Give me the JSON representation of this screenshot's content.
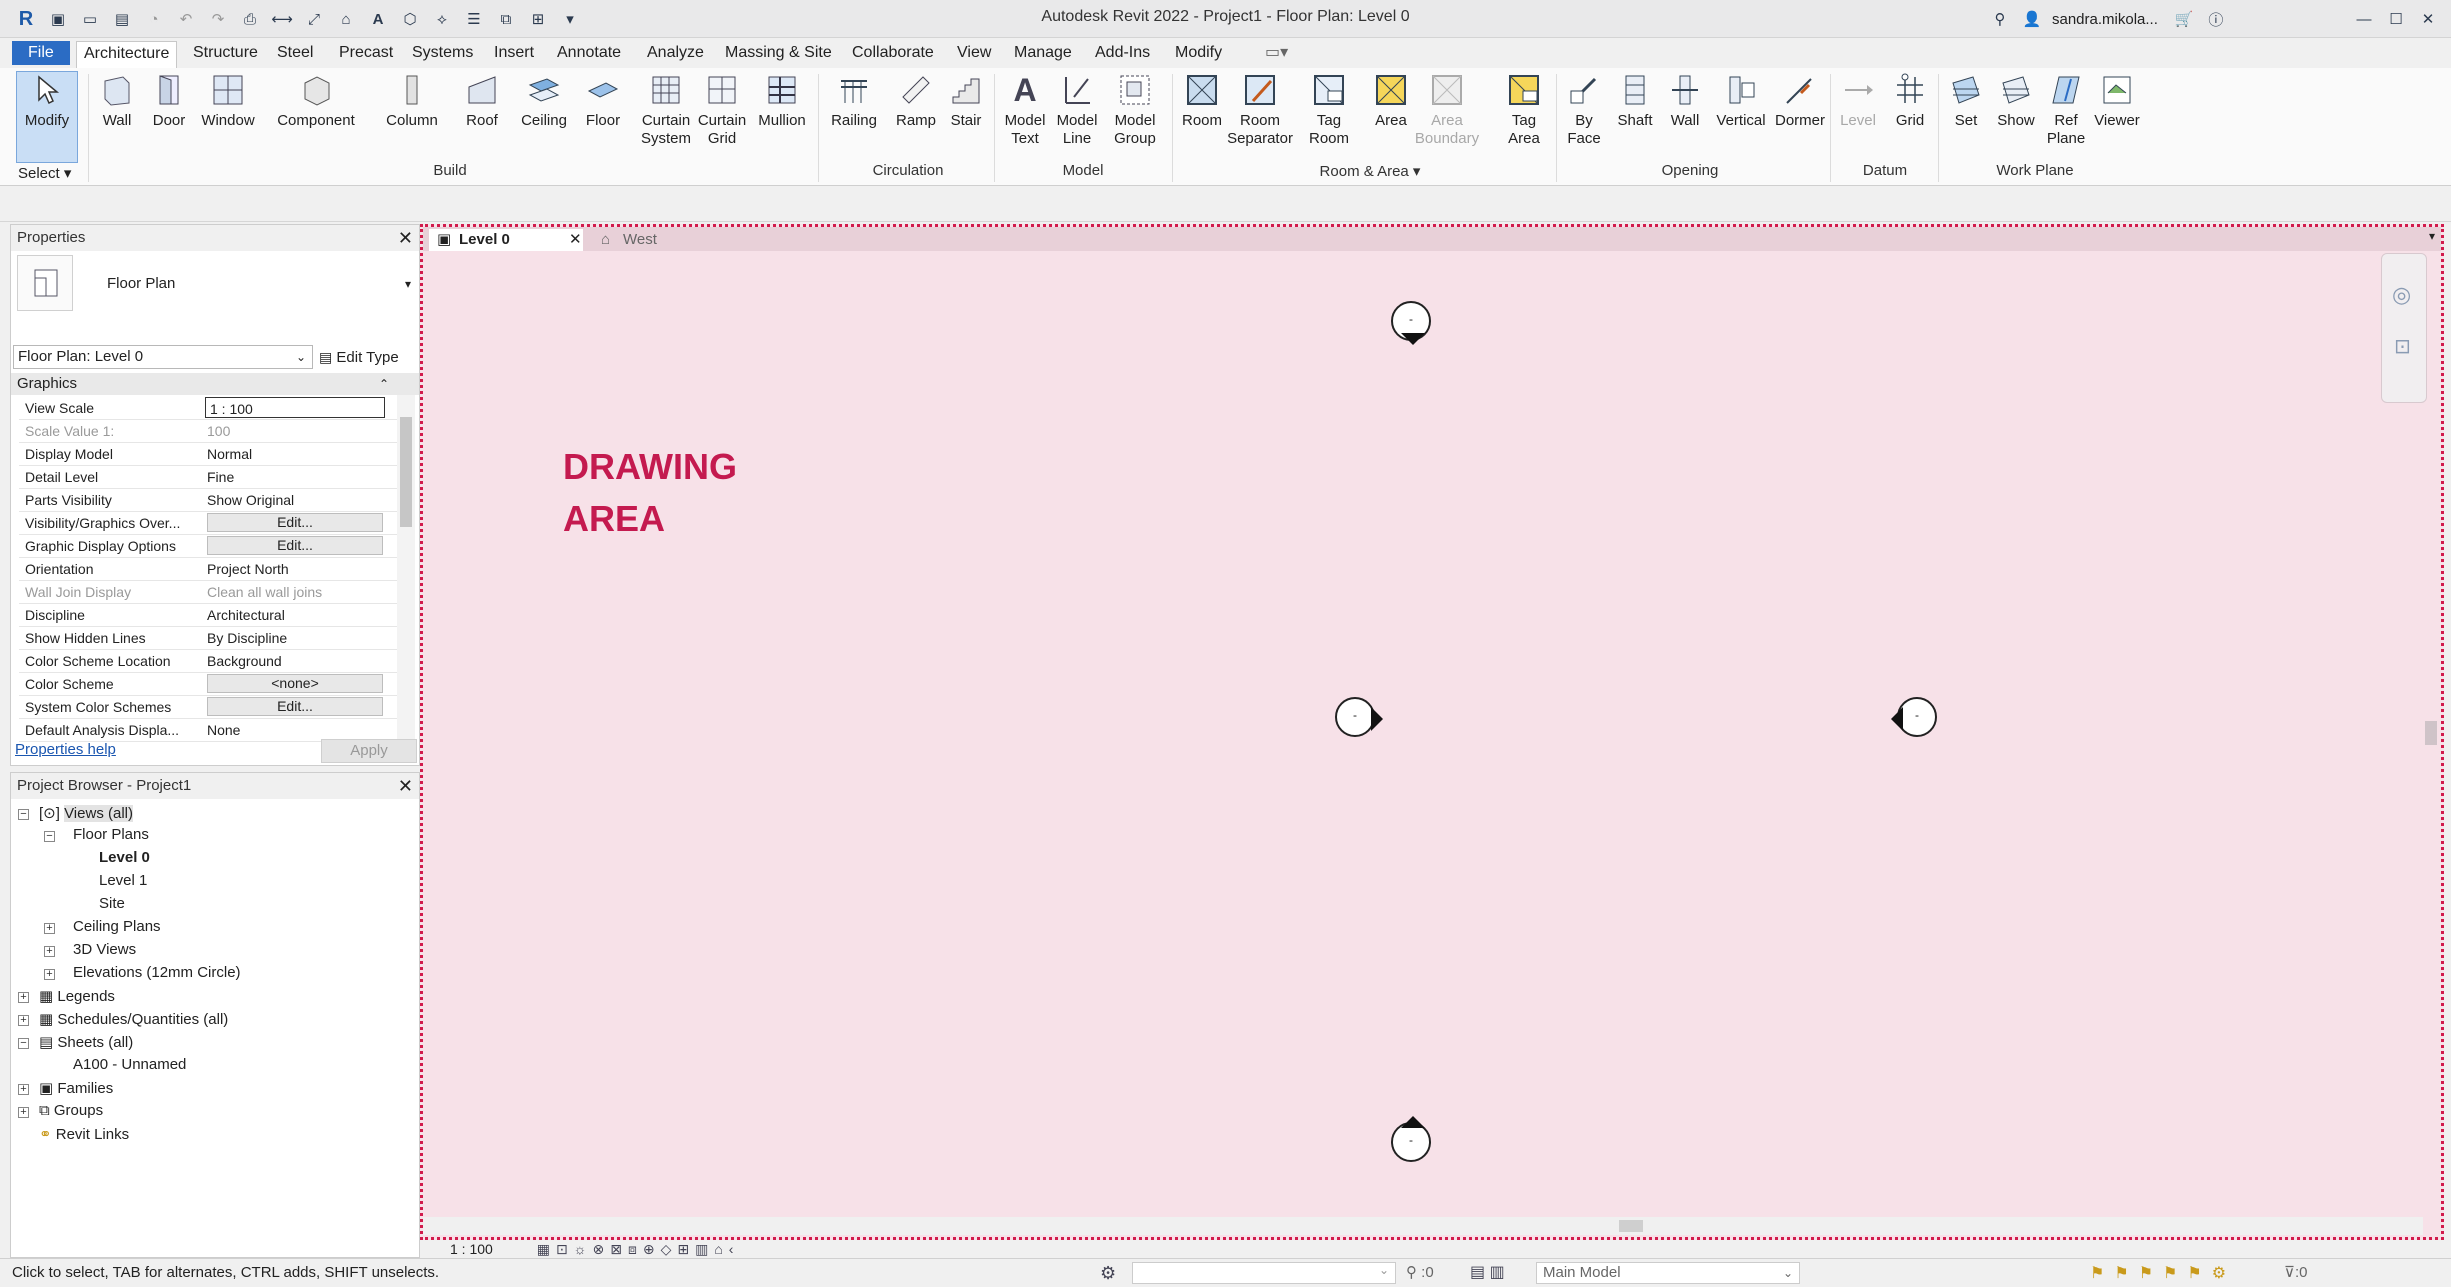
{
  "window": {
    "title": "Autodesk Revit 2022 - Project1 - Floor Plan: Level 0",
    "user": "sandra.mikola..."
  },
  "tabs": [
    "File",
    "Architecture",
    "Structure",
    "Steel",
    "Precast",
    "Systems",
    "Insert",
    "Annotate",
    "Analyze",
    "Massing & Site",
    "Collaborate",
    "View",
    "Manage",
    "Add-Ins",
    "Modify"
  ],
  "ribbon": {
    "select_label": "Select",
    "buttons": {
      "modify": "Modify",
      "wall": "Wall",
      "door": "Door",
      "window": "Window",
      "component": "Component",
      "column": "Column",
      "roof": "Roof",
      "ceiling": "Ceiling",
      "floor": "Floor",
      "curtain_system": "Curtain System",
      "curtain_grid": "Curtain Grid",
      "mullion": "Mullion",
      "railing": "Railing",
      "ramp": "Ramp",
      "stair": "Stair",
      "model_text": "Model Text",
      "model_line": "Model Line",
      "model_group": "Model Group",
      "room": "Room",
      "room_separator": "Room Separator",
      "tag_room": "Tag Room",
      "area": "Area",
      "area_boundary": "Area Boundary",
      "tag_area": "Tag Area",
      "by_face": "By Face",
      "shaft": "Shaft",
      "wall_opening": "Wall",
      "vertical": "Vertical",
      "dormer": "Dormer",
      "level": "Level",
      "grid": "Grid",
      "set": "Set",
      "show": "Show",
      "ref_plane": "Ref Plane",
      "viewer": "Viewer"
    },
    "panels": {
      "build": "Build",
      "circulation": "Circulation",
      "model": "Model",
      "room_area": "Room & Area ▾",
      "opening": "Opening",
      "datum": "Datum",
      "work_plane": "Work Plane"
    }
  },
  "properties": {
    "title": "Properties",
    "type_name": "Floor Plan",
    "selector": "Floor Plan: Level 0",
    "edit_type": "Edit Type",
    "group": "Graphics",
    "rows": [
      {
        "k": "View Scale",
        "v": "1 : 100"
      },
      {
        "k": "Scale Value    1:",
        "v": "100"
      },
      {
        "k": "Display Model",
        "v": "Normal"
      },
      {
        "k": "Detail Level",
        "v": "Fine"
      },
      {
        "k": "Parts Visibility",
        "v": "Show Original"
      },
      {
        "k": "Visibility/Graphics Over...",
        "v": "Edit..."
      },
      {
        "k": "Graphic Display Options",
        "v": "Edit..."
      },
      {
        "k": "Orientation",
        "v": "Project North"
      },
      {
        "k": "Wall Join Display",
        "v": "Clean all wall joins"
      },
      {
        "k": "Discipline",
        "v": "Architectural"
      },
      {
        "k": "Show Hidden Lines",
        "v": "By Discipline"
      },
      {
        "k": "Color Scheme Location",
        "v": "Background"
      },
      {
        "k": "Color Scheme",
        "v": "<none>"
      },
      {
        "k": "System Color Schemes",
        "v": "Edit..."
      },
      {
        "k": "Default Analysis Displa...",
        "v": "None"
      }
    ],
    "help": "Properties help",
    "apply": "Apply"
  },
  "browser": {
    "title": "Project Browser - Project1",
    "nodes": {
      "views": "Views (all)",
      "floor_plans": "Floor Plans",
      "level0": "Level 0",
      "level1": "Level 1",
      "site": "Site",
      "ceiling_plans": "Ceiling Plans",
      "views3d": "3D Views",
      "elevations": "Elevations (12mm Circle)",
      "legends": "Legends",
      "schedules": "Schedules/Quantities (all)",
      "sheets": "Sheets (all)",
      "a100": "A100 - Unnamed",
      "families": "Families",
      "groups": "Groups",
      "revit_links": "Revit Links"
    }
  },
  "view_tabs": {
    "active": "Level 0",
    "other": "West"
  },
  "drawing": {
    "annotation_line1": "DRAWING",
    "annotation_line2": "AREA",
    "marker_glyph": "-"
  },
  "view_control": {
    "scale": "1 : 100"
  },
  "status": {
    "hint": "Click to select, TAB for alternates, CTRL adds, SHIFT unselects.",
    "selection_count": ":0",
    "model": "Main Model",
    "filter_count": ":0"
  },
  "colors": {
    "file_tab": "#2b6cc4",
    "drawing_bg": "#f7e1e8",
    "drawing_border": "#d11b4c",
    "annotation": "#c41a4f"
  }
}
